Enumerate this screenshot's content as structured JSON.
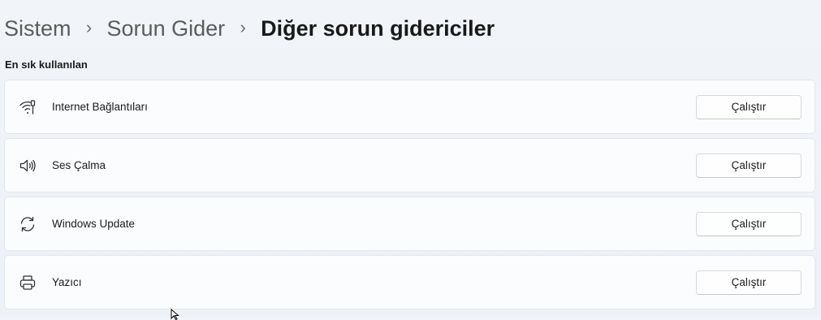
{
  "breadcrumb": {
    "items": [
      "Sistem",
      "Sorun Gider",
      "Diğer sorun gidericiler"
    ],
    "separator": "›"
  },
  "section": {
    "title": "En sık kullanılan"
  },
  "troubleshooters": [
    {
      "label": "Internet Bağlantıları",
      "icon": "wifi-icon",
      "button": "Çalıştır"
    },
    {
      "label": "Ses Çalma",
      "icon": "speaker-icon",
      "button": "Çalıştır"
    },
    {
      "label": "Windows Update",
      "icon": "sync-icon",
      "button": "Çalıştır"
    },
    {
      "label": "Yazıcı",
      "icon": "printer-icon",
      "button": "Çalıştır"
    }
  ]
}
